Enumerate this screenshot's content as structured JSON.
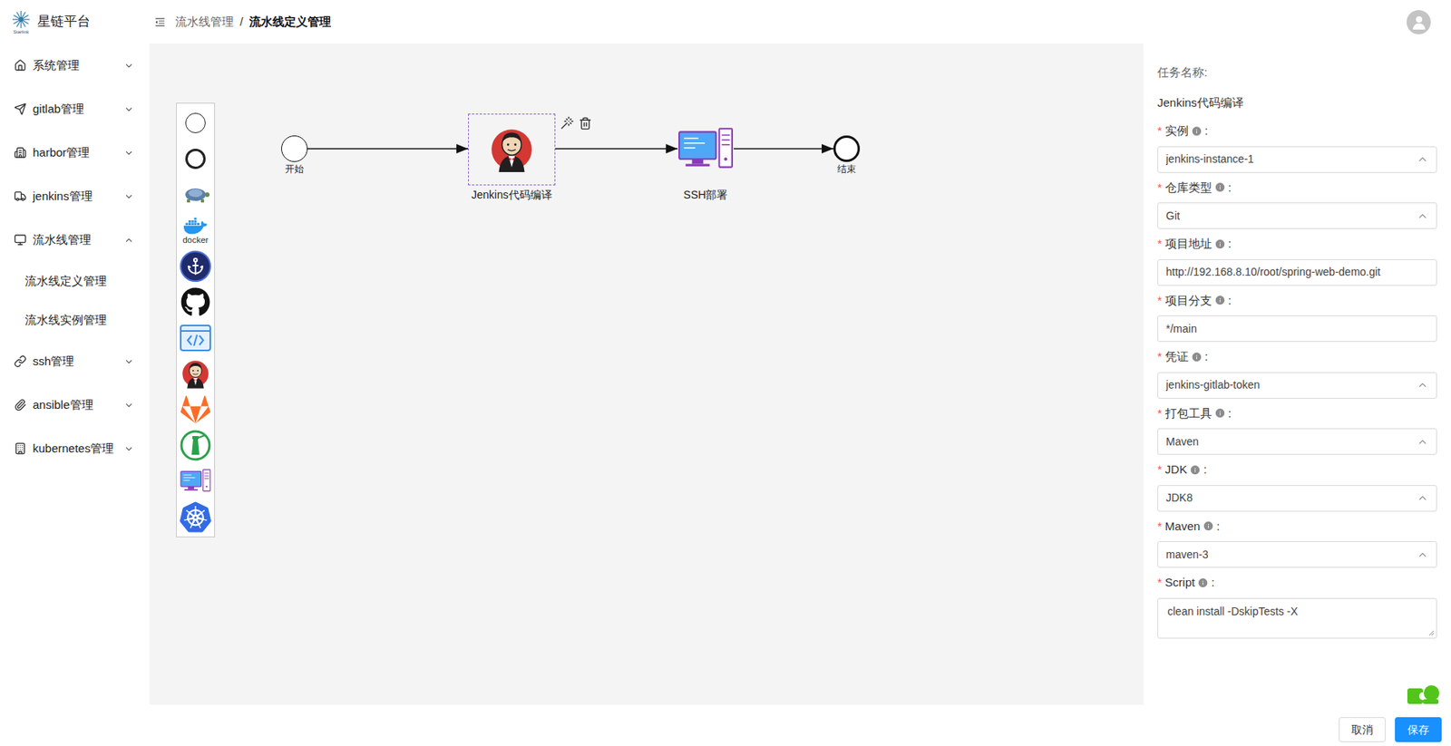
{
  "app": {
    "title": "星链平台",
    "logo_caption": "Starlink"
  },
  "sidebar": {
    "items": [
      {
        "label": "系统管理",
        "expanded": false,
        "children": []
      },
      {
        "label": "gitlab管理",
        "expanded": false,
        "children": []
      },
      {
        "label": "harbor管理",
        "expanded": false,
        "children": []
      },
      {
        "label": "jenkins管理",
        "expanded": false,
        "children": []
      },
      {
        "label": "流水线管理",
        "expanded": true,
        "children": [
          {
            "label": "流水线定义管理",
            "selected": false
          },
          {
            "label": "流水线实例管理",
            "selected": false
          }
        ]
      },
      {
        "label": "ssh管理",
        "expanded": false,
        "children": []
      },
      {
        "label": "ansible管理",
        "expanded": false,
        "children": []
      },
      {
        "label": "kubernetes管理",
        "expanded": false,
        "children": []
      }
    ]
  },
  "breadcrumb": {
    "separator": "/",
    "items": [
      {
        "label": "流水线管理",
        "current": false
      },
      {
        "label": "流水线定义管理",
        "current": true
      }
    ]
  },
  "palette": [
    {
      "kind": "start-event"
    },
    {
      "kind": "end-event"
    },
    {
      "kind": "turtle"
    },
    {
      "kind": "docker",
      "label": "docker"
    },
    {
      "kind": "harbor"
    },
    {
      "kind": "github"
    },
    {
      "kind": "code"
    },
    {
      "kind": "jenkins"
    },
    {
      "kind": "gitlab"
    },
    {
      "kind": "ansible"
    },
    {
      "kind": "ssh"
    },
    {
      "kind": "kubernetes"
    }
  ],
  "diagram": {
    "nodes": [
      {
        "kind": "start",
        "label": "开始",
        "selected": false
      },
      {
        "kind": "jenkins",
        "label": "Jenkins代码编译",
        "selected": true
      },
      {
        "kind": "ssh",
        "label": "SSH部署",
        "selected": false
      },
      {
        "kind": "end",
        "label": "结束",
        "selected": false
      }
    ]
  },
  "panel": {
    "task_label": "任务名称:",
    "task_value": "Jenkins代码编译",
    "label_suffix": ":",
    "fields": [
      {
        "label": "实例",
        "required": true,
        "kind": "select",
        "value": "jenkins-instance-1"
      },
      {
        "label": "仓库类型",
        "required": true,
        "kind": "select",
        "value": "Git"
      },
      {
        "label": "项目地址",
        "required": true,
        "kind": "input",
        "value": "http://192.168.8.10/root/spring-web-demo.git"
      },
      {
        "label": "项目分支",
        "required": true,
        "kind": "input",
        "value": "*/main"
      },
      {
        "label": "凭证",
        "required": true,
        "kind": "select",
        "value": "jenkins-gitlab-token"
      },
      {
        "label": "打包工具",
        "required": true,
        "kind": "select",
        "value": "Maven"
      },
      {
        "label": "JDK",
        "required": true,
        "kind": "select",
        "value": "JDK8"
      },
      {
        "label": "Maven",
        "required": true,
        "kind": "select",
        "value": "maven-3"
      },
      {
        "label": "Script",
        "required": true,
        "kind": "textarea",
        "value": "clean install -DskipTests -X"
      }
    ]
  },
  "buttons": [
    {
      "label": "取消",
      "primary": false
    },
    {
      "label": "保存",
      "primary": true
    }
  ]
}
